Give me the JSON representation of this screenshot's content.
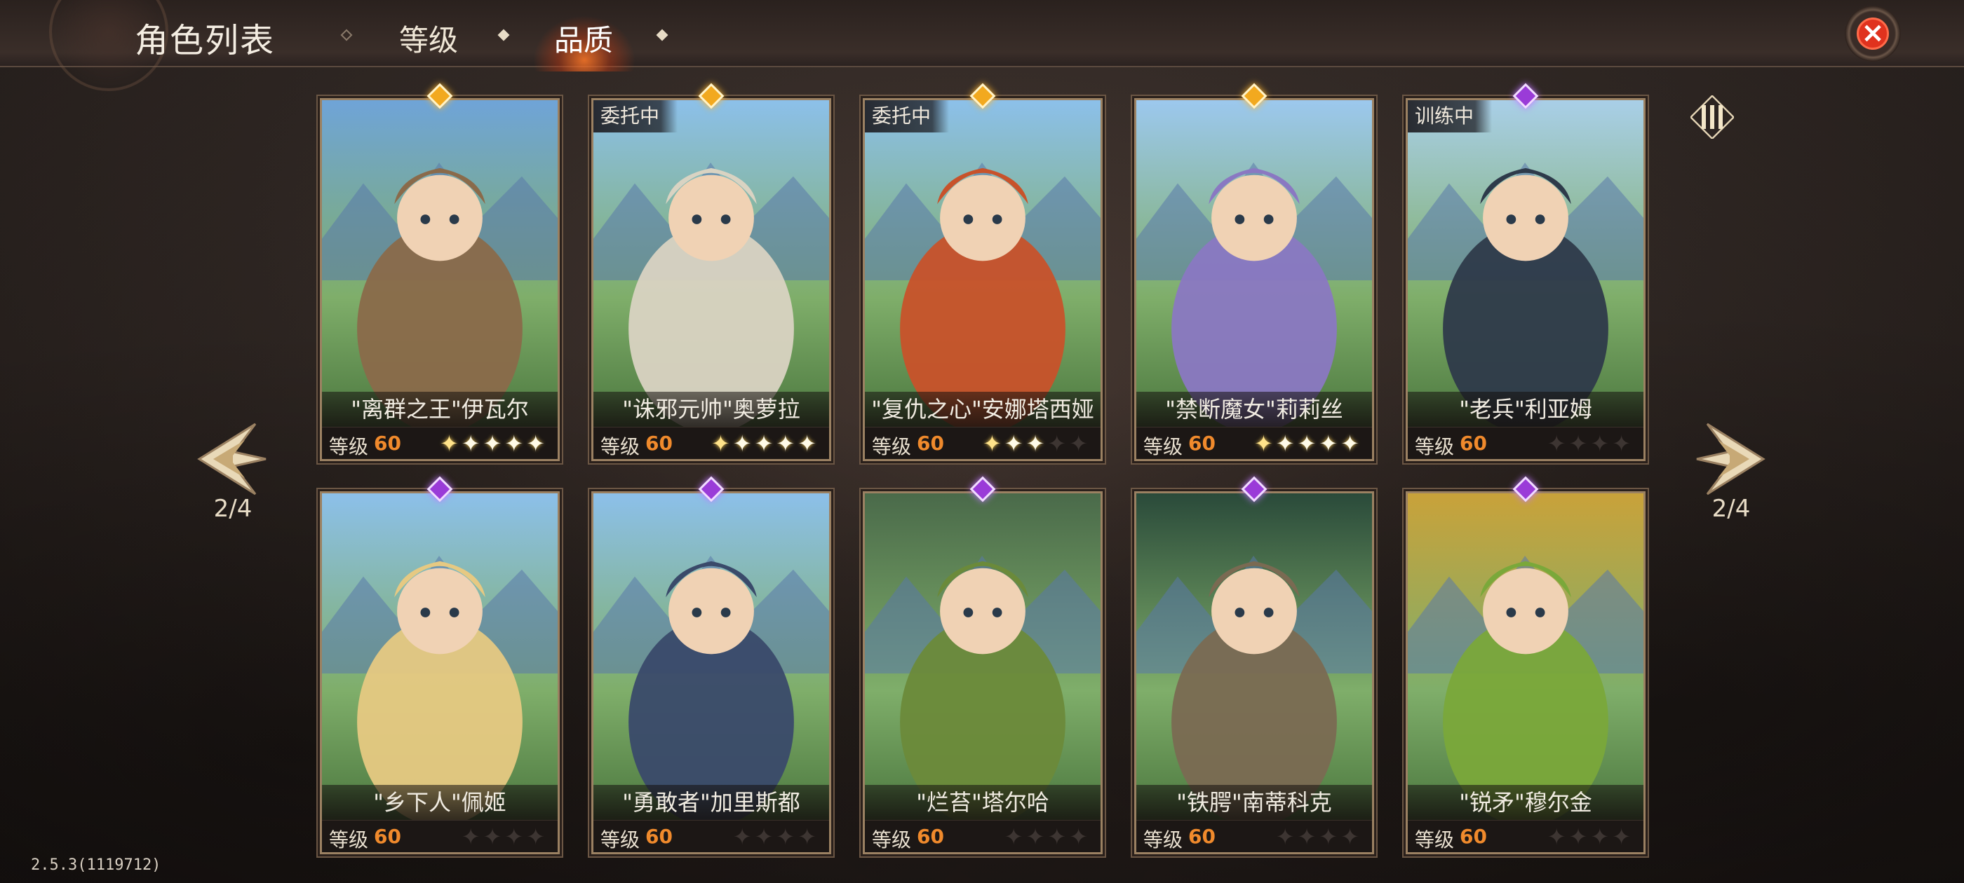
{
  "header": {
    "title": "角色列表",
    "tabs": [
      {
        "label": "等级",
        "active": false
      },
      {
        "label": "品质",
        "active": true
      }
    ]
  },
  "pagination": {
    "left_indicator": "2/4",
    "right_indicator": "2/4"
  },
  "level_label": "等级",
  "characters": [
    {
      "name": "\"离群之王\"伊瓦尔",
      "level": "60",
      "stars": 5,
      "filled_stars": 5,
      "gem": "gold",
      "status": "",
      "art_color": "#8a6a4a",
      "sky": "#6fa4d8"
    },
    {
      "name": "\"诛邪元帅\"奥萝拉",
      "level": "60",
      "stars": 5,
      "filled_stars": 5,
      "gem": "gold",
      "status": "委托中",
      "art_color": "#d9d3c2",
      "sky": "#8cc0ea"
    },
    {
      "name": "\"复仇之心\"安娜塔西娅",
      "level": "60",
      "stars": 5,
      "filled_stars": 3,
      "gem": "gold",
      "status": "委托中",
      "art_color": "#c8522a",
      "sky": "#8cc0ea"
    },
    {
      "name": "\"禁断魔女\"莉莉丝",
      "level": "60",
      "stars": 5,
      "filled_stars": 5,
      "gem": "gold",
      "status": "",
      "art_color": "#8a78c2",
      "sky": "#9cc8ee"
    },
    {
      "name": "\"老兵\"利亚姆",
      "level": "60",
      "stars": 4,
      "filled_stars": 0,
      "gem": "purple",
      "status": "训练中",
      "art_color": "#2e3a4a",
      "sky": "#a9cfe8"
    },
    {
      "name": "\"乡下人\"佩姬",
      "level": "60",
      "stars": 4,
      "filled_stars": 0,
      "gem": "purple",
      "status": "",
      "art_color": "#e6c982",
      "sky": "#8cc0ea"
    },
    {
      "name": "\"勇敢者\"加里斯都",
      "level": "60",
      "stars": 4,
      "filled_stars": 0,
      "gem": "purple",
      "status": "",
      "art_color": "#3a4a6a",
      "sky": "#8cc0ea"
    },
    {
      "name": "\"烂苔\"塔尔哈",
      "level": "60",
      "stars": 4,
      "filled_stars": 0,
      "gem": "purple",
      "status": "",
      "art_color": "#6b8a3a",
      "sky": "#4a6a4a"
    },
    {
      "name": "\"铁腭\"南蒂科克",
      "level": "60",
      "stars": 4,
      "filled_stars": 0,
      "gem": "purple",
      "status": "",
      "art_color": "#7a6a52",
      "sky": "#2a4a3a"
    },
    {
      "name": "\"锐矛\"穆尔金",
      "level": "60",
      "stars": 4,
      "filled_stars": 0,
      "gem": "purple",
      "status": "",
      "art_color": "#7aa83a",
      "sky": "#c9a23a"
    }
  ],
  "version": "2.5.3(1119712)"
}
